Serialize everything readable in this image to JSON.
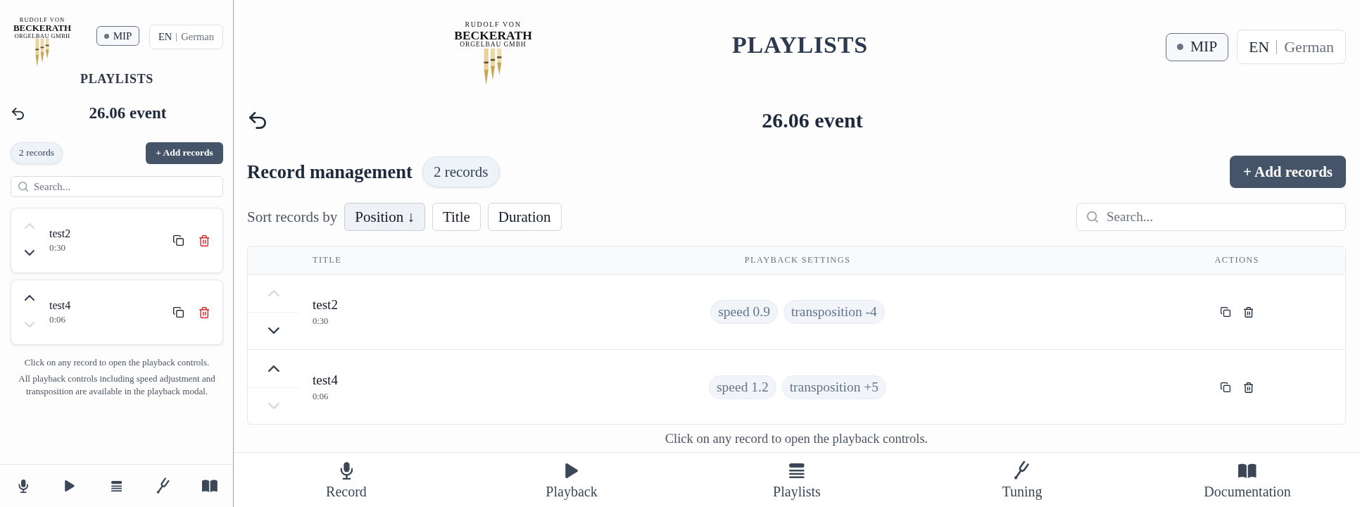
{
  "preview": {
    "logo": {
      "top": "RUDOLF VON",
      "name": "BECKERATH",
      "bottom": "ORGELBAU GMBH"
    },
    "mode_button": "MIP",
    "languages": [
      {
        "label": "EN",
        "selected": true
      },
      {
        "label": "German",
        "selected": false
      }
    ],
    "page_title": "PLAYLISTS",
    "playlist_title": "26.06 event",
    "record_count": "2 records",
    "add_button": "+ Add records",
    "search": {
      "placeholder": "Search..."
    },
    "records": [
      {
        "title": "test2",
        "duration": "0:30",
        "up_disabled": true,
        "down_disabled": false
      },
      {
        "title": "test4",
        "duration": "0:06",
        "up_disabled": false,
        "down_disabled": true
      }
    ],
    "help": [
      "Click on any record to open the playback controls.",
      "All playback controls including speed adjustment and transposition are available in the playback modal."
    ]
  },
  "main": {
    "logo": {
      "top": "RUDOLF VON",
      "name": "BECKERATH",
      "bottom": "ORGELBAU GMBH"
    },
    "page_title": "PLAYLISTS",
    "mode_button": "MIP",
    "languages": [
      {
        "label": "EN",
        "selected": true
      },
      {
        "label": "German",
        "selected": false
      }
    ],
    "playlist_title": "26.06 event",
    "section_title": "Record management",
    "record_count": "2 records",
    "add_button": "+ Add records",
    "sort": {
      "label": "Sort records by",
      "options": [
        {
          "label": "Position ↓",
          "selected": true
        },
        {
          "label": "Title",
          "selected": false
        },
        {
          "label": "Duration",
          "selected": false
        }
      ]
    },
    "search": {
      "placeholder": "Search..."
    },
    "table": {
      "columns": [
        "TITLE",
        "PLAYBACK SETTINGS",
        "ACTIONS"
      ],
      "rows": [
        {
          "title": "test2",
          "duration": "0:30",
          "settings": [
            "speed 0.9",
            "transposition -4"
          ],
          "up_disabled": true,
          "down_disabled": false
        },
        {
          "title": "test4",
          "duration": "0:06",
          "settings": [
            "speed 1.2",
            "transposition +5"
          ],
          "up_disabled": false,
          "down_disabled": true
        }
      ]
    },
    "help": "Click on any record to open the playback controls.",
    "nav": [
      {
        "label": "Record"
      },
      {
        "label": "Playback"
      },
      {
        "label": "Playlists"
      },
      {
        "label": "Tuning"
      },
      {
        "label": "Documentation"
      }
    ]
  }
}
